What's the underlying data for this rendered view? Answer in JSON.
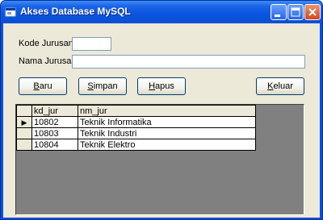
{
  "window": {
    "title": "Akses Database MySQL",
    "accent": "#0a50d8",
    "face": "#ece9d8"
  },
  "form": {
    "kode_label": "Kode Jurusan",
    "kode_value": "",
    "nama_label": "Nama Jurusan",
    "nama_value": ""
  },
  "buttons": {
    "baru": {
      "key": "B",
      "rest": "aru"
    },
    "simpan": {
      "key": "S",
      "rest": "impan"
    },
    "hapus": {
      "key": "H",
      "rest": "apus"
    },
    "keluar": {
      "key": "K",
      "rest": "eluar"
    }
  },
  "grid": {
    "columns": [
      "kd_jur",
      "nm_jur"
    ],
    "current_row_indicator": "▶",
    "rows": [
      {
        "kd_jur": "10802",
        "nm_jur": "Teknik Informatika"
      },
      {
        "kd_jur": "10803",
        "nm_jur": "Teknik Industri"
      },
      {
        "kd_jur": "10804",
        "nm_jur": "Teknik Elektro"
      }
    ]
  }
}
